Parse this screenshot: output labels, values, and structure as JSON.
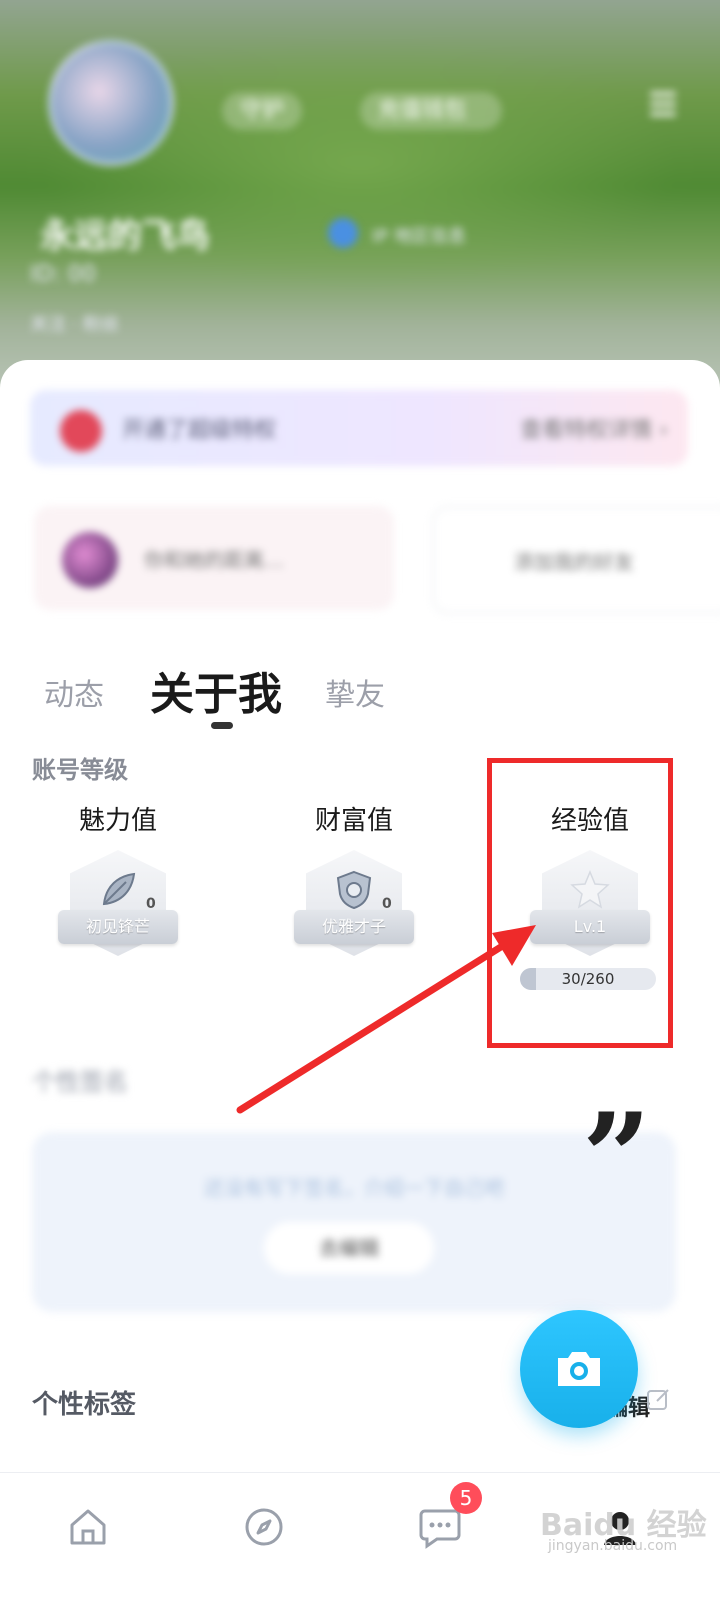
{
  "header": {
    "chip_1": "守护",
    "chip_2": "充值钱包",
    "name": "永远的飞鸟",
    "verify": "IP 地区信息",
    "sub_line": "ID: 00",
    "sub_line_2": "关注 · 粉丝"
  },
  "banner": {
    "text": "开通了超级特权",
    "action": "查看特权详情 ›"
  },
  "cards": {
    "left": "你和她的距离…",
    "right": "添加我的好友"
  },
  "tabs": [
    {
      "label": "动态"
    },
    {
      "label": "关于我"
    },
    {
      "label": "挚友"
    }
  ],
  "levels": {
    "section_title": "账号等级",
    "items": [
      {
        "label": "魅力值",
        "badge_title": "初见锋芒",
        "badge_num": "0"
      },
      {
        "label": "财富值",
        "badge_title": "优雅才子",
        "badge_num": "0"
      },
      {
        "label": "经验值",
        "badge_title": "Lv.1",
        "progress_text": "30/260",
        "progress_current": 30,
        "progress_max": 260
      }
    ]
  },
  "intro": {
    "section_title": "个性签名",
    "text": "还没有写下签名，介绍一下自己吧",
    "button": "去编辑"
  },
  "tags": {
    "section_title": "个性标签",
    "edit_partial": "编辑"
  },
  "nav": {
    "items": [
      "home",
      "discover",
      "messages",
      "profile"
    ],
    "message_badge": "5"
  },
  "watermark": {
    "text": "Baidu 经验",
    "sub": "jingyan.baidu.com"
  },
  "colors": {
    "accent": "#18b0ea",
    "annotation": "#ee2a2a",
    "badge": "#ff4d5a"
  }
}
